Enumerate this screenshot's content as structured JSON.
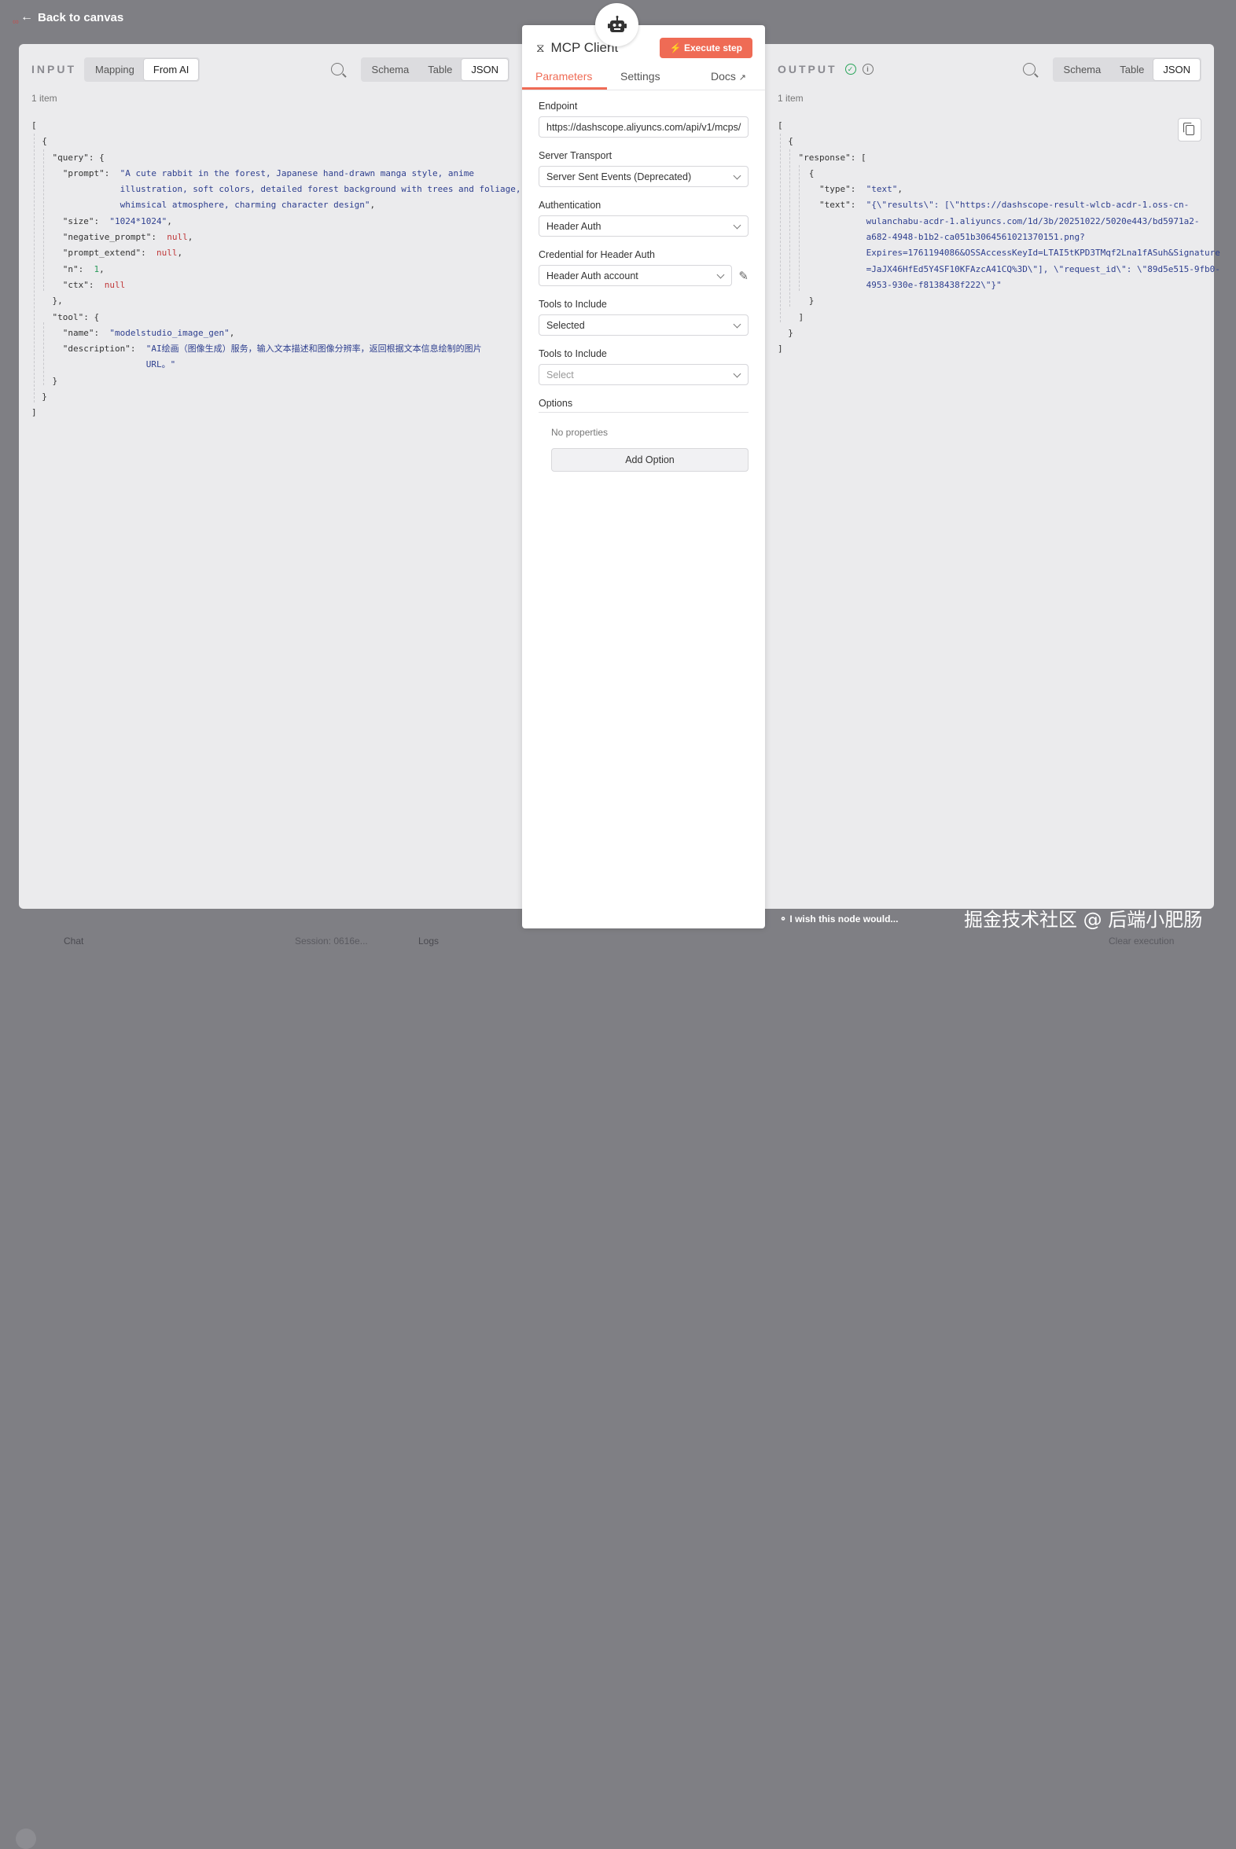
{
  "topbar": {
    "back_label": "Back to canvas"
  },
  "input": {
    "title": "INPUT",
    "mode_tabs": [
      "Mapping",
      "From AI"
    ],
    "view_tabs": [
      "Schema",
      "Table",
      "JSON"
    ],
    "item_count": "1 item",
    "json": {
      "prompt_l1": "\"A cute rabbit in the forest, Japanese hand-drawn manga style, anime",
      "prompt_l2": "illustration, soft colors, detailed forest background with trees and foliage,",
      "prompt_l3": "whimsical atmosphere, charming character design\"",
      "size": "\"1024*1024\"",
      "negative_prompt": "null",
      "prompt_extend": "null",
      "n": "1",
      "ctx": "null",
      "tool_name": "\"modelstudio_image_gen\"",
      "desc_l1": "\"AI绘画（图像生成）服务，输入文本描述和图像分辨率，返回根据文本信息绘制的图片",
      "desc_l2": "URL。\""
    }
  },
  "node": {
    "title": "MCP Client",
    "execute_label": "Execute step",
    "tabs": {
      "parameters": "Parameters",
      "settings": "Settings",
      "docs": "Docs"
    },
    "fields": {
      "endpoint_label": "Endpoint",
      "endpoint_value": "https://dashscope.aliyuncs.com/api/v1/mcps/",
      "transport_label": "Server Transport",
      "transport_value": "Server Sent Events (Deprecated)",
      "auth_label": "Authentication",
      "auth_value": "Header Auth",
      "credential_label": "Credential for Header Auth",
      "credential_value": "Header Auth account",
      "tools_label": "Tools to Include",
      "tools_value": "Selected",
      "tools2_label": "Tools to Include",
      "tools2_placeholder": "Select",
      "options_label": "Options",
      "no_props": "No properties",
      "add_option": "Add Option"
    }
  },
  "output": {
    "title": "OUTPUT",
    "view_tabs": [
      "Schema",
      "Table",
      "JSON"
    ],
    "item_count": "1 item",
    "json": {
      "type_val": "\"text\"",
      "text_l1": "\"{\\\"results\\\": [\\\"https://dashscope-result-wlcb-acdr-1.oss-cn-",
      "text_l2": "wulanchabu-acdr-1.aliyuncs.com/1d/3b/20251022/5020e443/bd5971a2-",
      "text_l3": "a682-4948-b1b2-ca051b3064561021370151.png?",
      "text_l4": "Expires=1761194086&OSSAccessKeyId=LTAI5tKPD3TMqf2Lna1fASuh&Signature",
      "text_l5": "=JaJX46HfEd5Y4SF10KFAzcA41CQ%3D\\\"], \\\"request_id\\\": \\\"89d5e515-9fb0-",
      "text_l6": "4953-930e-f8138438f222\\\"}\""
    }
  },
  "bottom": {
    "wish": "I wish this node would...",
    "chat": "Chat",
    "session": "Session: 0616e...",
    "logs": "Logs",
    "clear": "Clear execution",
    "watermark": "掘金技术社区 @ 后端小肥肠"
  },
  "colors": {
    "accent": "#ef6b55",
    "success": "#2aa55a",
    "json_string": "#2e3f8f",
    "json_null": "#c0393b"
  }
}
